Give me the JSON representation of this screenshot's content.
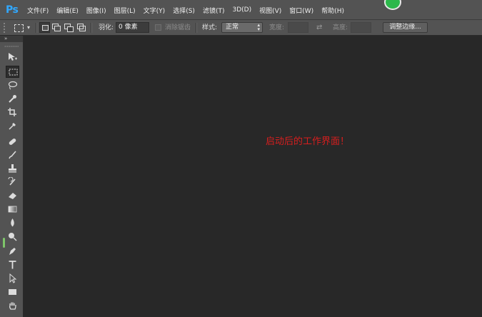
{
  "app": {
    "logo": "Ps"
  },
  "menu": [
    "文件(F)",
    "编辑(E)",
    "图像(I)",
    "图层(L)",
    "文字(Y)",
    "选择(S)",
    "滤镜(T)",
    "3D(D)",
    "视图(V)",
    "窗口(W)",
    "帮助(H)"
  ],
  "options": {
    "feather_label": "羽化:",
    "feather_value": "0 像素",
    "antialias_label": "消除锯齿",
    "style_label": "样式:",
    "style_value": "正常",
    "width_label": "宽度:",
    "height_label": "高度:",
    "refine_edge": "调整边缘..."
  },
  "toolbar": {
    "collapse_glyph": "»",
    "tools": [
      "move-tool",
      "rectangular-marquee-tool",
      "lasso-tool",
      "quick-selection-tool",
      "crop-tool",
      "eyedropper-tool",
      "spot-healing-brush-tool",
      "brush-tool",
      "clone-stamp-tool",
      "history-brush-tool",
      "eraser-tool",
      "gradient-tool",
      "blur-tool",
      "dodge-tool",
      "pen-tool",
      "type-tool",
      "path-selection-tool",
      "rectangle-tool",
      "hand-tool"
    ],
    "active_tool": "rectangular-marquee-tool"
  },
  "canvas": {
    "annotation": "启动后的工作界面！",
    "annotation_color": "#d81e1e"
  },
  "colors": {
    "ui_panel": "#535353",
    "workspace": "#282828",
    "logo_blue": "#31a8ff",
    "badge_green": "#2cb84b"
  }
}
